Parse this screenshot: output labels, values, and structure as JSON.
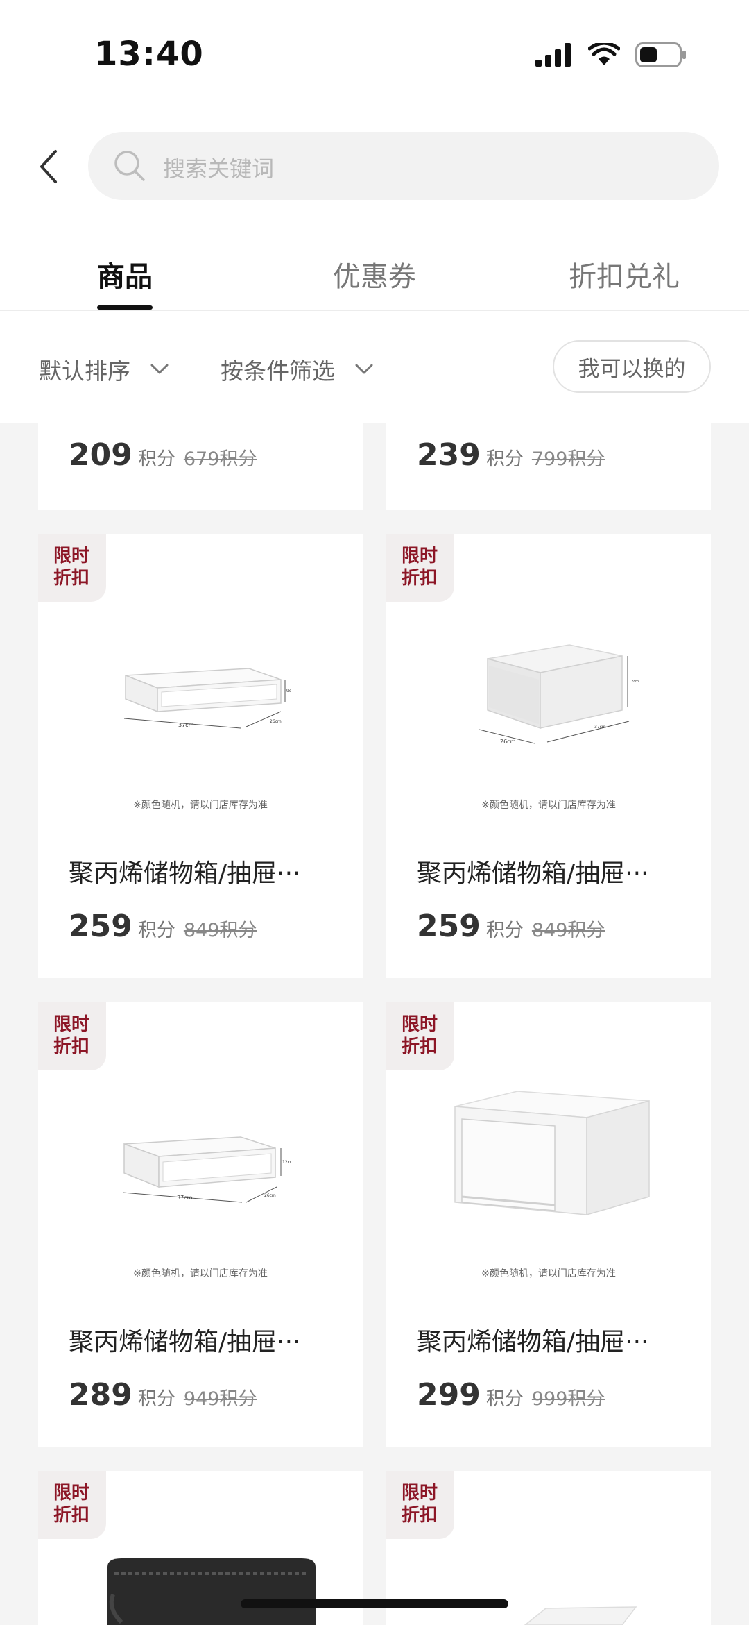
{
  "status_bar": {
    "time": "13:40"
  },
  "search": {
    "placeholder": "搜索关键词"
  },
  "tabs": [
    {
      "label": "商品",
      "active": true
    },
    {
      "label": "优惠券",
      "active": false
    },
    {
      "label": "折扣兑礼",
      "active": false
    }
  ],
  "filters": {
    "sort_label": "默认排序",
    "condition_label": "按条件筛选",
    "exchangeable_label": "我可以换的"
  },
  "products_partial_top": [
    {
      "price": "209",
      "unit": "积分",
      "original": "679积分"
    },
    {
      "price": "239",
      "unit": "积分",
      "original": "799积分"
    }
  ],
  "products": [
    {
      "badge": "限时折扣",
      "image_note": "※颜色随机，请以门店库存为准",
      "title": "聚丙烯储物箱/抽屉···",
      "price": "259",
      "unit": "积分",
      "original": "849积分",
      "image": "flat-drawer-box",
      "dims": [
        "37cm",
        "26cm",
        "9cm"
      ]
    },
    {
      "badge": "限时折扣",
      "image_note": "※颜色随机，请以门店库存为准",
      "title": "聚丙烯储物箱/抽屉···",
      "price": "259",
      "unit": "积分",
      "original": "849积分",
      "image": "frosted-drawer-box",
      "dims": [
        "26cm",
        "37cm",
        "12cm"
      ]
    },
    {
      "badge": "限时折扣",
      "image_note": "※颜色随机，请以门店库存为准",
      "title": "聚丙烯储物箱/抽屉···",
      "price": "289",
      "unit": "积分",
      "original": "949积分",
      "image": "flat-drawer-box",
      "dims": [
        "37cm",
        "26cm",
        "12cm"
      ]
    },
    {
      "badge": "限时折扣",
      "image_note": "※颜色随机，请以门店库存为准",
      "title": "聚丙烯储物箱/抽屉···",
      "price": "299",
      "unit": "积分",
      "original": "999积分",
      "image": "deep-drawer-box"
    }
  ],
  "products_partial_bottom": [
    {
      "badge": "限时折扣",
      "image": "black-travel-case"
    },
    {
      "badge": "限时折扣",
      "image": "white-box"
    }
  ],
  "colors": {
    "badge_text": "#8c1626",
    "badge_bg": "#f1eeee",
    "background": "#f4f4f4"
  }
}
